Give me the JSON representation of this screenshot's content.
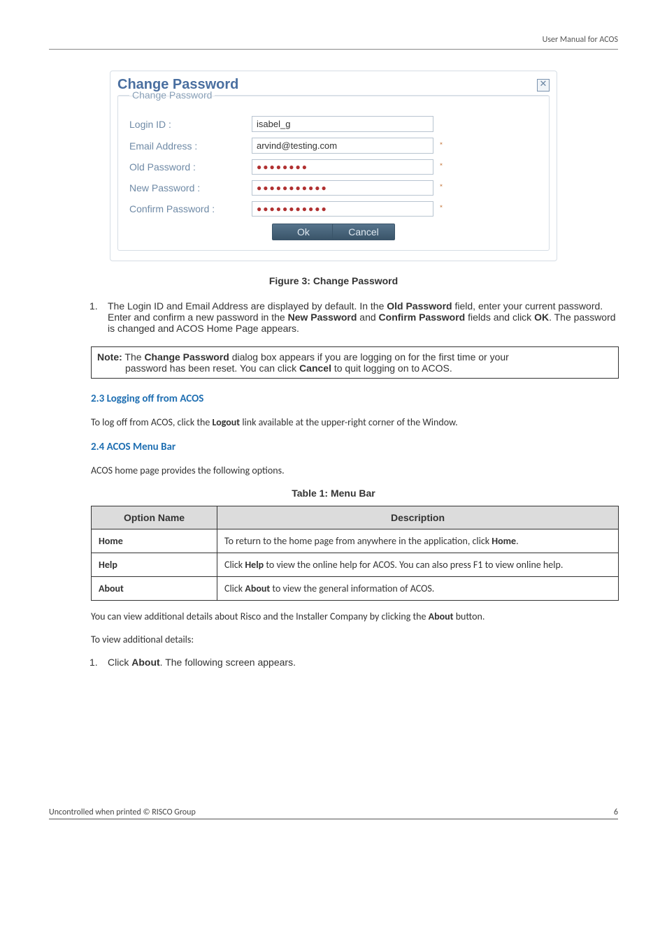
{
  "header": {
    "right": "User Manual for ACOS"
  },
  "dialog": {
    "title": "Change Password",
    "legend": "Change Password",
    "close_icon": "✕",
    "labels": {
      "login": "Login ID :",
      "email": "Email Address :",
      "old": "Old Password :",
      "new": "New Password :",
      "confirm": "Confirm Password :"
    },
    "values": {
      "login": "isabel_g",
      "email": "arvind@testing.com",
      "old": "●●●●●●●●",
      "new": "●●●●●●●●●●●",
      "confirm": "●●●●●●●●●●●"
    },
    "asterisk": "*",
    "buttons": {
      "ok": "Ok",
      "cancel": "Cancel"
    }
  },
  "figure_caption": "Figure 3: Change Password",
  "list1": {
    "marker": "1.",
    "pre": "The Login ID and Email Address are displayed by default. In the ",
    "b1": "Old Password",
    "mid1": " field, enter your current password. Enter and confirm a new password in the ",
    "b2": "New Password",
    "mid2": " and ",
    "b3": "Confirm Password",
    "mid3": " fields and click ",
    "b4": "OK",
    "suf": ". The password is changed and ACOS Home Page appears."
  },
  "note": {
    "label": "Note:",
    "t1": " The ",
    "b1": "Change Password",
    "t2": " dialog box appears if you are logging on for the first time or your",
    "line2a": "password has been reset. You can click ",
    "b2": "Cancel",
    "line2b": " to quit logging on to ACOS."
  },
  "sect23": {
    "heading": "2.3  Logging off from ACOS",
    "p_a": "To log off from ACOS, click the ",
    "p_b": "Logout",
    "p_c": " link available at the upper-right corner of the Window."
  },
  "sect24": {
    "heading": "2.4  ACOS Menu Bar",
    "intro": "ACOS home page provides the following options."
  },
  "table_caption": "Table 1: Menu Bar",
  "table": {
    "h1": "Option Name",
    "h2": "Description",
    "rows": [
      {
        "name": "Home",
        "d1": "To return to the home page from anywhere in the application, click ",
        "db": "Home",
        "d2": "."
      },
      {
        "name": "Help",
        "d1": "Click ",
        "db": "Help",
        "d2": " to view the online help for ACOS. You can also press F1 to view online help."
      },
      {
        "name": "About",
        "d1": "Click ",
        "db": "About",
        "d2": " to view the general information of ACOS."
      }
    ]
  },
  "after_table": {
    "p1a": "You can view additional details about Risco and the Installer Company by clicking the ",
    "p1b": "About",
    "p1c": " button.",
    "p2": "To view additional details:",
    "li_marker": "1.",
    "li_a": "Click ",
    "li_b": "About",
    "li_c": ". The following screen appears."
  },
  "footer": {
    "left": "Uncontrolled when printed © RISCO Group",
    "page": "6"
  }
}
